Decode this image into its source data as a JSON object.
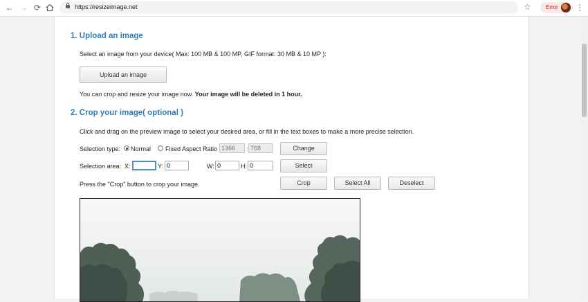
{
  "browser": {
    "url": "https://resizeimage.net",
    "error_label": "Error"
  },
  "section1": {
    "heading": "1. Upload an image",
    "instructions": "Select an image from your device( Max: 100 MB & 100 MP, GIF format: 30 MB & 10 MP ):",
    "upload_label": "Upload an image",
    "note_plain": "You can crop and resize your image now.",
    "note_bold": "Your image will be deleted in 1 hour."
  },
  "section2": {
    "heading": "2. Crop your image( optional )",
    "instructions": "Click and drag on the preview image to select your desired area, or fill in the text boxes to make a more precise selection.",
    "selection_type_label": "Selection type:",
    "normal_label": "Normal",
    "fixed_label": "Fixed Aspect Ratio",
    "ratio_w": "1366",
    "ratio_sep": ":",
    "ratio_h": "768",
    "change_label": "Change",
    "selection_area_label": "Selection area:",
    "x_label": "X:",
    "x_value": "",
    "y_label": "Y:",
    "y_value": "0",
    "w_label": "W:",
    "w_value": "0",
    "h_label": "H:",
    "h_value": "0",
    "select_label": "Select",
    "crop_hint": "Press the \"Crop\" button to crop your image.",
    "crop_label": "Crop",
    "select_all_label": "Select All",
    "deselect_label": "Deselect"
  }
}
